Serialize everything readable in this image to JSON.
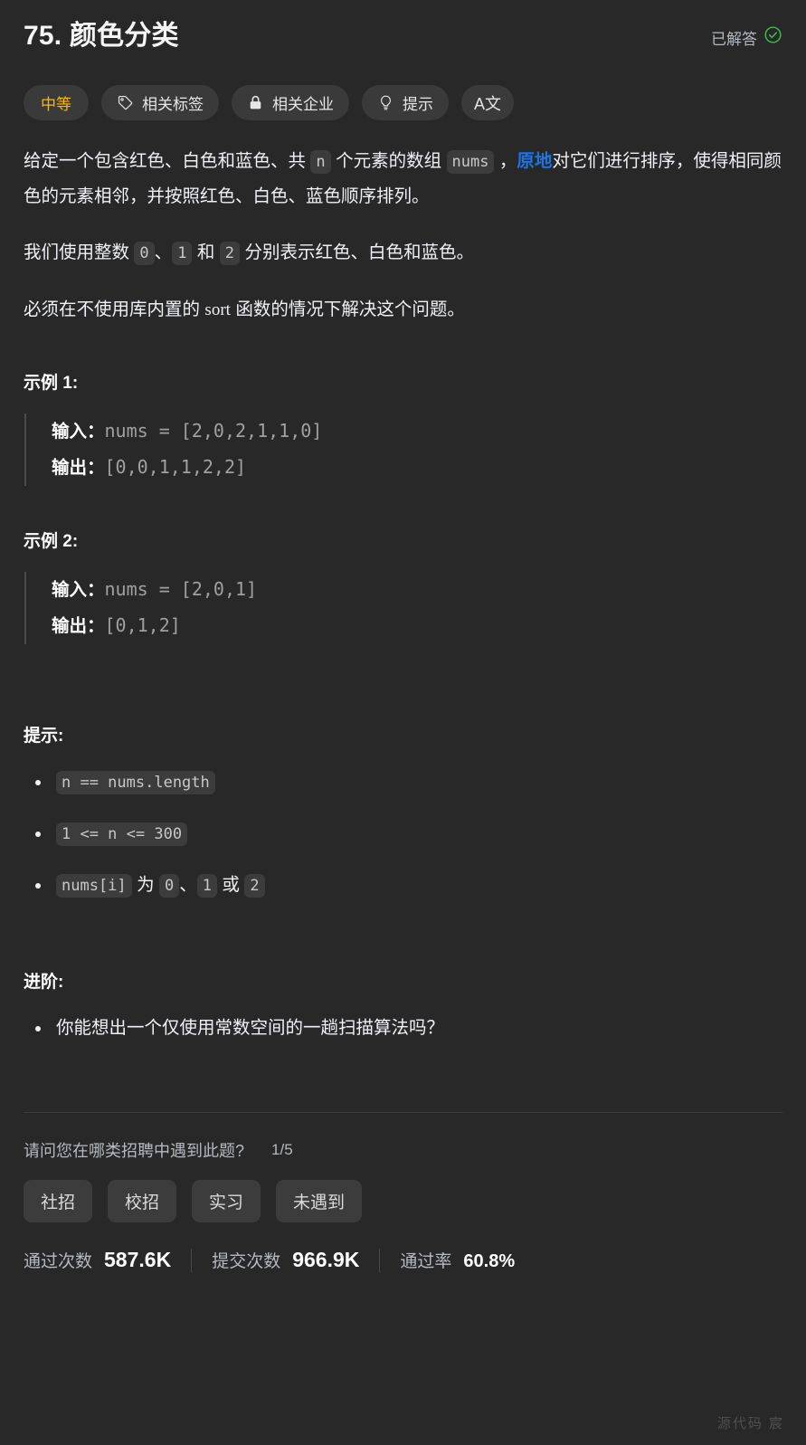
{
  "header": {
    "title": "75. 颜色分类",
    "solved_label": "已解答",
    "solved_icon": "circle-check-icon",
    "accent_green": "#3fb950"
  },
  "toolbar": {
    "difficulty": "中等",
    "difficulty_color": "#ffb800",
    "items": [
      {
        "label": "相关标签",
        "icon": "tag-icon"
      },
      {
        "label": "相关企业",
        "icon": "lock-icon"
      },
      {
        "label": "提示",
        "icon": "lightbulb-icon"
      }
    ],
    "language_label": "A文",
    "language_icon": "translate-icon"
  },
  "description": {
    "p1_a": "给定一个包含红色、白色和蓝色、共 ",
    "p1_code_n": "n",
    "p1_b": " 个元素的数组 ",
    "p1_code_nums": "nums",
    "p1_c": " ，",
    "p1_link": "原地",
    "p1_d": "对它们进行排序，使得相同颜色的元素相邻，并按照红色、白色、蓝色顺序排列。",
    "p2_a": "我们使用整数 ",
    "p2_code_0": "0",
    "p2_b": "、",
    "p2_code_1": "1",
    "p2_c": " 和 ",
    "p2_code_2": "2",
    "p2_d": " 分别表示红色、白色和蓝色。",
    "p3_a": "必须在不使用库内置的 ",
    "p3_sort": "sort",
    "p3_b": " 函数的情况下解决这个问题。"
  },
  "examples": [
    {
      "heading": "示例 1:",
      "input_label": "输入：",
      "input_value": "nums = [2,0,2,1,1,0]",
      "output_label": "输出：",
      "output_value": "[0,0,1,1,2,2]"
    },
    {
      "heading": "示例 2:",
      "input_label": "输入：",
      "input_value": "nums = [2,0,1]",
      "output_label": "输出：",
      "output_value": "[0,1,2]"
    }
  ],
  "constraints": {
    "heading": "提示:",
    "items": [
      {
        "code1": "n == nums.length",
        "text": "",
        "code2": "",
        "text2": "",
        "code3": "",
        "text3": "",
        "code4": ""
      },
      {
        "code1": "1 <= n <= 300",
        "text": "",
        "code2": "",
        "text2": "",
        "code3": "",
        "text3": "",
        "code4": ""
      },
      {
        "code1": "nums[i]",
        "text": " 为 ",
        "code2": "0",
        "text2": "、",
        "code3": "1",
        "text3": " 或 ",
        "code4": "2"
      }
    ]
  },
  "followup": {
    "heading": "进阶:",
    "items": [
      "你能想出一个仅使用常数空间的一趟扫描算法吗？"
    ]
  },
  "survey": {
    "question": "请问您在哪类招聘中遇到此题?",
    "counter": "1/5",
    "options": [
      "社招",
      "校招",
      "实习",
      "未遇到"
    ]
  },
  "stats": [
    {
      "label": "通过次数",
      "value": "587.6K"
    },
    {
      "label": "提交次数",
      "value": "966.9K"
    },
    {
      "label": "通过率",
      "value": "60.8%"
    }
  ],
  "watermark": "源代码  宸"
}
